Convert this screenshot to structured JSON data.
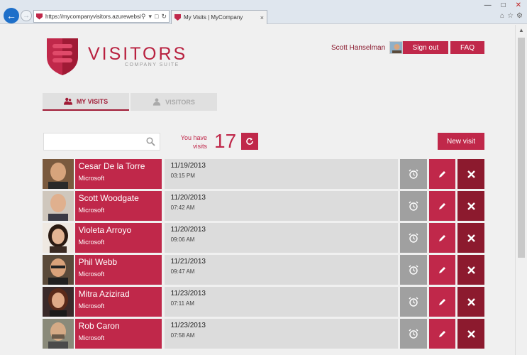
{
  "browser": {
    "url": "https://mycompanyvisitors.azurewebsit...",
    "tab_title": "My Visits | MyCompany"
  },
  "header": {
    "logo_title": "VISITORS",
    "logo_subtitle": "COMPANY SUITE",
    "username": "Scott Hanselman",
    "signout_label": "Sign out",
    "faq_label": "FAQ"
  },
  "tabs": [
    {
      "label": "MY VISITS",
      "active": true
    },
    {
      "label": "VISITORS",
      "active": false
    }
  ],
  "toolbar": {
    "search_placeholder": "",
    "you_have_label": "You have visits",
    "visit_count": "17",
    "new_visit_label": "New visit"
  },
  "visits": [
    {
      "name": "Cesar De la Torre",
      "company": "Microsoft",
      "date": "11/19/2013",
      "time": "03:15 PM"
    },
    {
      "name": "Scott Woodgate",
      "company": "Microsoft",
      "date": "11/20/2013",
      "time": "07:42 AM"
    },
    {
      "name": "Violeta Arroyo",
      "company": "Microsoft",
      "date": "11/20/2013",
      "time": "09:06 AM"
    },
    {
      "name": "Phil Webb",
      "company": "Microsoft",
      "date": "11/21/2013",
      "time": "09:47 AM"
    },
    {
      "name": "Mitra Azizirad",
      "company": "Microsoft",
      "date": "11/23/2013",
      "time": "07:11 AM"
    },
    {
      "name": "Rob Caron",
      "company": "Microsoft",
      "date": "11/23/2013",
      "time": "07:58 AM"
    }
  ],
  "colors": {
    "brand": "#c0284a",
    "brand_dark": "#8c1a2e",
    "alarm_gray": "#a0a0a0"
  }
}
